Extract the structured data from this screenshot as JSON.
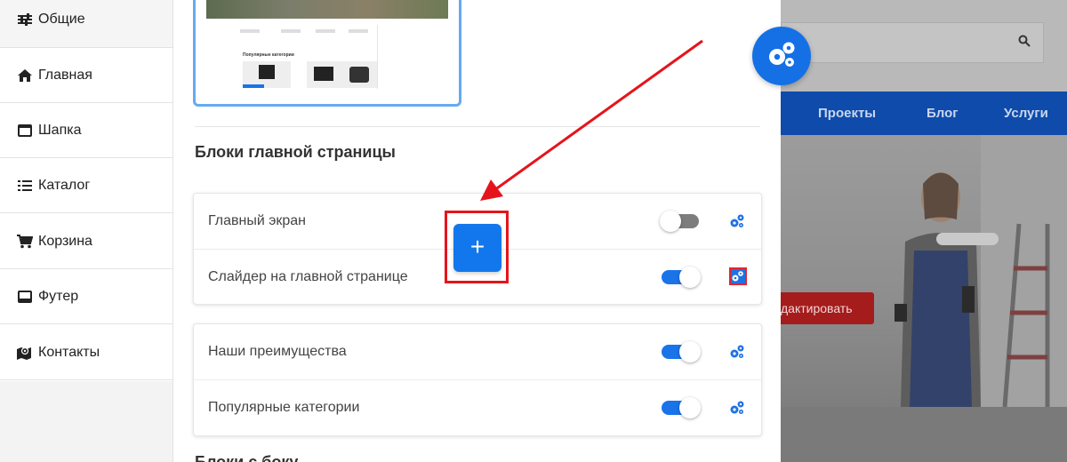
{
  "sidebar": {
    "items": [
      {
        "label": "Общие",
        "icon": "sliders-icon"
      },
      {
        "label": "Главная",
        "icon": "home-icon"
      },
      {
        "label": "Шапка",
        "icon": "window-icon"
      },
      {
        "label": "Каталог",
        "icon": "list-icon"
      },
      {
        "label": "Корзина",
        "icon": "cart-icon"
      },
      {
        "label": "Футер",
        "icon": "window-icon"
      },
      {
        "label": "Контакты",
        "icon": "map-pin-icon"
      }
    ]
  },
  "main": {
    "section_title": "Блоки главной страницы",
    "section_title_next": "Блоки с боку",
    "group1": [
      {
        "label": "Главный экран",
        "enabled": false
      },
      {
        "label": "Слайдер на главной странице",
        "enabled": true
      }
    ],
    "group2": [
      {
        "label": "Наши преимущества",
        "enabled": true
      },
      {
        "label": "Популярные категории",
        "enabled": true
      }
    ],
    "add_label": "+",
    "thumbnail": {
      "section_label": "Популярные категории"
    }
  },
  "preview": {
    "nav": [
      "Проекты",
      "Блог",
      "Услуги"
    ],
    "edit_label": "дактировать"
  },
  "colors": {
    "accent": "#1277ec",
    "highlight": "#e5141b"
  }
}
